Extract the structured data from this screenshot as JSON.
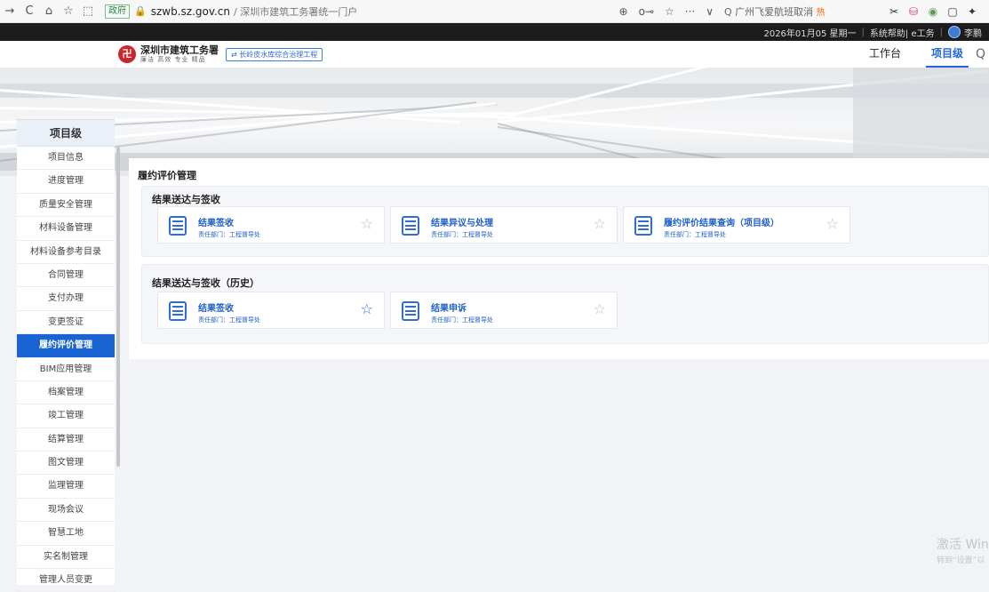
{
  "browser": {
    "nav": [
      "→",
      "C",
      "⌂",
      "☆",
      "⬚"
    ],
    "tag": "政府",
    "domain": "szwb.sz.gov.cn",
    "path": "/ 深圳市建筑工务署统一门户",
    "tools": [
      "⊕",
      "o⊸",
      "☆",
      "···",
      "∨"
    ],
    "search_text": "广州飞爱航班取消",
    "hot_label": "热",
    "right_tools": [
      "✂",
      "⛁",
      "◉",
      "▢",
      "✦"
    ]
  },
  "infobar": {
    "date": "2026年01月05 星期一",
    "system": "系统帮助| e工务",
    "user": "李鹏"
  },
  "header": {
    "logo_glyph": "卍",
    "org_name": "深圳市建筑工务署",
    "org_motto": "廉洁 高效 专业 精品",
    "project_chip": "长岭皮水库综合治理工程",
    "nav": [
      "工作台",
      "项目级"
    ],
    "search_icon": "Q"
  },
  "sidebar": {
    "title": "项目级",
    "items": [
      "项目信息",
      "进度管理",
      "质量安全管理",
      "材料设备管理",
      "材料设备参考目录",
      "合同管理",
      "支付办理",
      "变更签证",
      "履约评价管理",
      "BIM应用管理",
      "档案管理",
      "竣工管理",
      "结算管理",
      "图文管理",
      "监理管理",
      "现场会议",
      "智慧工地",
      "实名制管理",
      "管理人员变更"
    ],
    "active_index": 8
  },
  "main": {
    "title": "履约评价管理",
    "groups": [
      {
        "title": "结果送达与签收",
        "cards": [
          {
            "title": "结果签收",
            "dept": "责任部门：工程督导处",
            "starred": false
          },
          {
            "title": "结果异议与处理",
            "dept": "责任部门：工程督导处",
            "starred": false
          },
          {
            "title": "履约评价结果查询（项目级）",
            "dept": "责任部门：工程督导处",
            "starred": false
          }
        ]
      },
      {
        "title": "结果送达与签收（历史）",
        "cards": [
          {
            "title": "结果签收",
            "dept": "责任部门：工程督导处",
            "starred": true
          },
          {
            "title": "结果申诉",
            "dept": "责任部门：工程督导处",
            "starred": false
          }
        ]
      }
    ]
  },
  "watermark": {
    "line1": "激活 Wind",
    "line2": "转到“设置”以"
  },
  "colors": {
    "accent": "#1964d2",
    "card_text": "#1f5fc9",
    "logo_red": "#c9272d"
  }
}
